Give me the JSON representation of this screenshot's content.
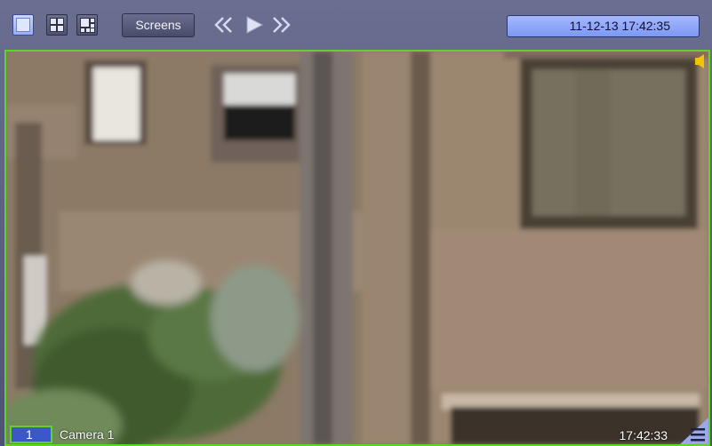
{
  "toolbar": {
    "layouts": [
      {
        "name": "single",
        "icon": "layout-1x1-icon",
        "active": true
      },
      {
        "name": "quad",
        "icon": "layout-2x2-icon",
        "active": false
      },
      {
        "name": "multi",
        "icon": "layout-multi-icon",
        "active": false
      }
    ],
    "screens_label": "Screens",
    "nav": {
      "rewind_icon": "double-chevron-left-icon",
      "play_icon": "play-icon",
      "forward_icon": "double-chevron-right-icon"
    },
    "datetime": "11-12-13   17:42:35"
  },
  "video": {
    "camera_number": "1",
    "camera_name": "Camera 1",
    "timestamp": "17:42:33",
    "speaker_icon": "speaker-icon",
    "menu_icon": "hamburger-menu-icon"
  },
  "colors": {
    "active_border": "#5fd32a",
    "toolbar_bg": "#5a5e7e",
    "clock_bg": "#8ea6f8",
    "camera_badge": "#3c57c6"
  }
}
